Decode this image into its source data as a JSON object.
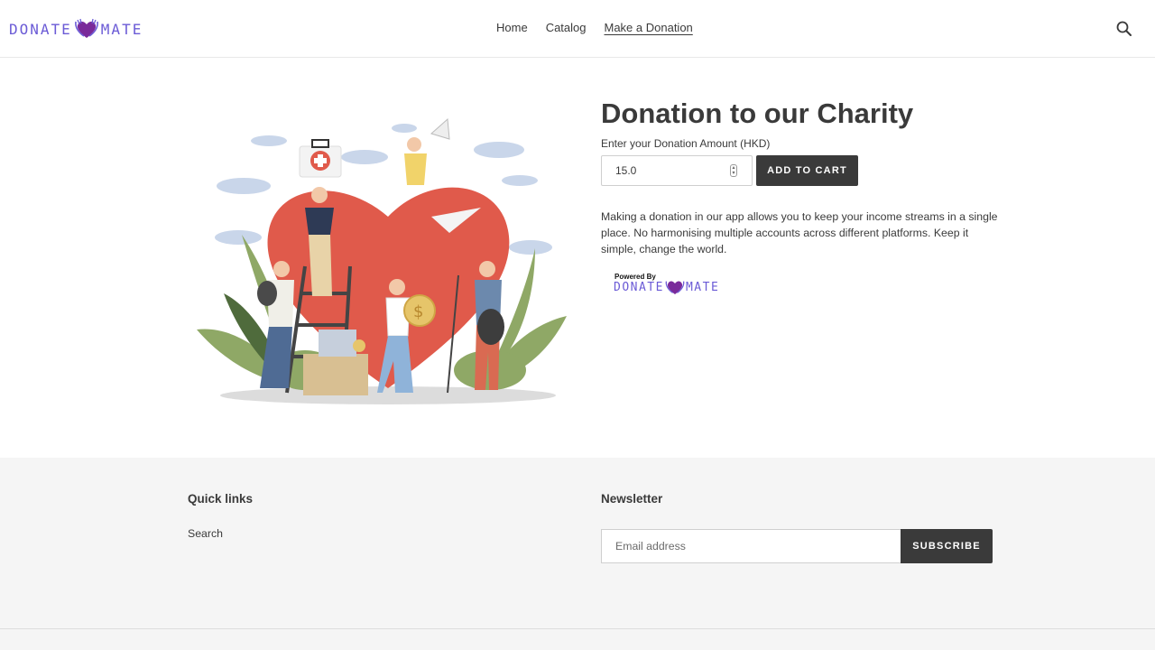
{
  "brand": {
    "logo_left": "DONATE",
    "logo_right": "MATE",
    "accent_color": "#6b5bd6",
    "heart_color": "#7a2a9a"
  },
  "nav": {
    "items": [
      {
        "label": "Home",
        "active": false
      },
      {
        "label": "Catalog",
        "active": false
      },
      {
        "label": "Make a Donation",
        "active": true
      }
    ],
    "search_icon": "search-icon"
  },
  "product": {
    "title": "Donation to our Charity",
    "amount_label": "Enter your Donation Amount (HKD)",
    "amount_value": "15.0",
    "add_to_cart_label": "ADD TO CART",
    "description": "Making a donation in our app allows you to keep your income streams in a single place. No harmonising multiple accounts across different platforms. Keep it simple, change the world.",
    "powered_by": "Powered By",
    "hero_image": "charity-volunteers-illustration"
  },
  "footer": {
    "quick_links_heading": "Quick links",
    "quick_links": [
      {
        "label": "Search"
      }
    ],
    "newsletter_heading": "Newsletter",
    "email_placeholder": "Email address",
    "subscribe_label": "SUBSCRIBE"
  },
  "colors": {
    "button_bg": "#3a3a3a",
    "footer_bg": "#f5f5f5",
    "heart_red": "#e05a4b",
    "leaf_green": "#8fa866"
  }
}
